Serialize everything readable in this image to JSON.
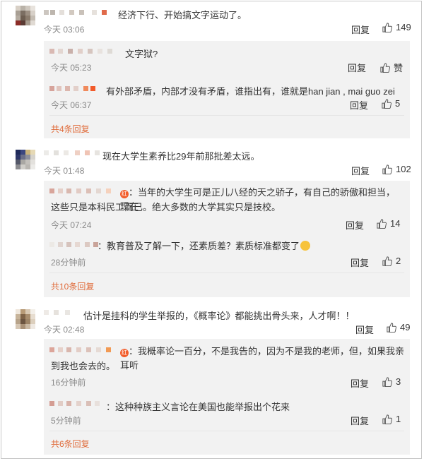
{
  "comments": [
    {
      "text": "经济下行、开始搞文字运动了。",
      "time": "今天 03:06",
      "reply_label": "回复",
      "likes": "149",
      "replies": [
        {
          "text": "文字狱?",
          "time": "今天 05:23",
          "reply_label": "回复",
          "likes": "赞"
        },
        {
          "text": "有外部矛盾，内部才没有矛盾，谁指出有，谁就是han jian , mai guo zei",
          "time": "今天 06:37",
          "reply_label": "回复",
          "likes": "5"
        }
      ],
      "more": "共4条回复"
    },
    {
      "text": "现在大学生素养比29年前那批差太远。",
      "time": "今天 01:48",
      "reply_label": "回复",
      "likes": "102",
      "replies": [
        {
          "badge": "红",
          "text_line1": "当年的大学生可是正儿八经的天之骄子，有自己的骄傲和担当，现在",
          "text_line2": "这些只是本科民工而已。绝大多数的大学其实只是技校。",
          "time": "今天 07:24",
          "reply_label": "回复",
          "likes": "14"
        },
        {
          "text": "教育普及了解一下，还素质差？素质标准都变了",
          "time": "28分钟前",
          "reply_label": "回复",
          "likes": "2"
        }
      ],
      "more": "共10条回复"
    },
    {
      "text": "估计是挂科的学生举报的，《概率论》都能挑出骨头来，人才啊！！",
      "time": "今天 02:48",
      "reply_label": "回复",
      "likes": "49",
      "replies": [
        {
          "badge": "红",
          "text_line1": "我概率论一百分，不是我告的，因为不是我的老师，但，如果我亲耳听",
          "text_line2": "到我也会去的。",
          "time": "16分钟前",
          "reply_label": "回复",
          "likes": "3"
        },
        {
          "text": "这种种族主义言论在美国也能举报出个花来",
          "time": "5分钟前",
          "reply_label": "回复",
          "likes": "1"
        }
      ],
      "more": "共6条回复"
    }
  ]
}
